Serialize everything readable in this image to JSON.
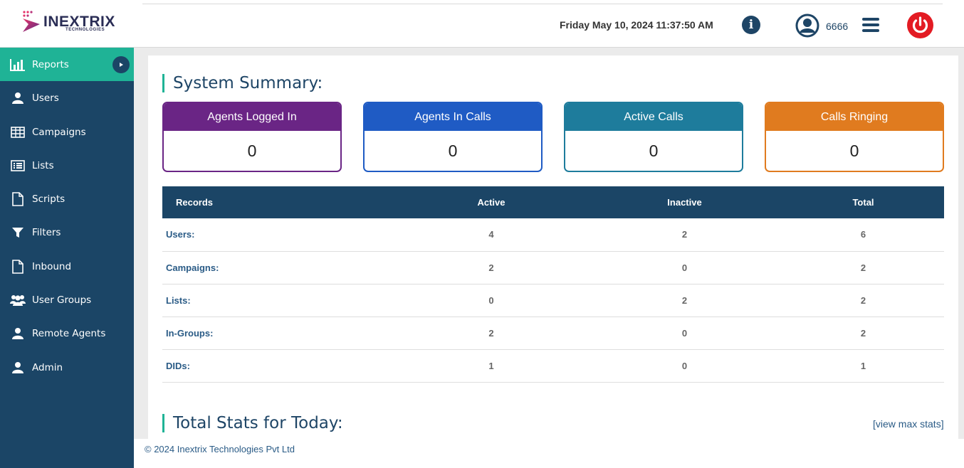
{
  "header": {
    "logo_text": "INEXTRIX",
    "logo_sub": "TECHNOLOGIES",
    "datetime": "Friday May 10, 2024 11:37:50 AM",
    "extension": "6666",
    "icons": [
      "info-icon",
      "user-icon",
      "menu-icon",
      "power-icon"
    ],
    "colors": {
      "power": "#e31b23",
      "info": "#1e4566"
    }
  },
  "sidebar": {
    "items": [
      {
        "label": "Reports",
        "icon": "bar-chart-icon",
        "active": true
      },
      {
        "label": "Users",
        "icon": "user-icon"
      },
      {
        "label": "Campaigns",
        "icon": "table-icon"
      },
      {
        "label": "Lists",
        "icon": "list-icon"
      },
      {
        "label": "Scripts",
        "icon": "file-icon"
      },
      {
        "label": "Filters",
        "icon": "filter-icon"
      },
      {
        "label": "Inbound",
        "icon": "file-icon"
      },
      {
        "label": "User Groups",
        "icon": "users-icon"
      },
      {
        "label": "Remote Agents",
        "icon": "user-icon"
      },
      {
        "label": "Admin",
        "icon": "user-icon"
      }
    ],
    "colors": {
      "background": "#1b4566",
      "active": "#1fb396"
    }
  },
  "main": {
    "summary_title": "System Summary:",
    "cards": [
      {
        "label": "Agents Logged In",
        "value": "0",
        "color": "#6a2585"
      },
      {
        "label": "Agents In Calls",
        "value": "0",
        "color": "#1f5bc4"
      },
      {
        "label": "Active Calls",
        "value": "0",
        "color": "#1e7c9c"
      },
      {
        "label": "Calls Ringing",
        "value": "0",
        "color": "#e07b1f"
      }
    ],
    "table": {
      "headers": [
        "Records",
        "Active",
        "Inactive",
        "Total"
      ],
      "rows": [
        [
          "Users:",
          "4",
          "2",
          "6"
        ],
        [
          "Campaigns:",
          "2",
          "0",
          "2"
        ],
        [
          "Lists:",
          "0",
          "2",
          "2"
        ],
        [
          "In-Groups:",
          "2",
          "0",
          "2"
        ],
        [
          "DIDs:",
          "1",
          "0",
          "1"
        ]
      ]
    },
    "stats_title": "Total Stats for Today:",
    "view_max_link": "[view max stats]"
  },
  "footer": {
    "copyright": "© 2024 Inextrix Technologies Pvt Ltd"
  }
}
